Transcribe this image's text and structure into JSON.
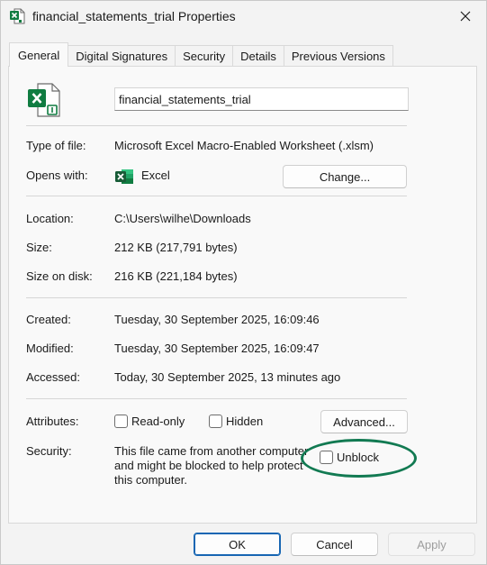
{
  "window": {
    "title": "financial_statements_trial Properties",
    "close_glyph": "✕"
  },
  "tabs": [
    {
      "label": "General",
      "active": true
    },
    {
      "label": "Digital Signatures",
      "active": false
    },
    {
      "label": "Security",
      "active": false
    },
    {
      "label": "Details",
      "active": false
    },
    {
      "label": "Previous Versions",
      "active": false
    }
  ],
  "general": {
    "file_name": "financial_statements_trial",
    "type_label": "Type of file:",
    "type_value": "Microsoft Excel Macro-Enabled Worksheet (.xlsm)",
    "opens_label": "Opens with:",
    "opens_value": "Excel",
    "change_button": "Change...",
    "location_label": "Location:",
    "location_value": "C:\\Users\\wilhe\\Downloads",
    "size_label": "Size:",
    "size_value": "212 KB (217,791 bytes)",
    "size_disk_label": "Size on disk:",
    "size_disk_value": "216 KB (221,184 bytes)",
    "created_label": "Created:",
    "created_value": "Tuesday, 30 September 2025, 16:09:46",
    "modified_label": "Modified:",
    "modified_value": "Tuesday, 30 September 2025, 16:09:47",
    "accessed_label": "Accessed:",
    "accessed_value": "Today, 30 September 2025, 13 minutes ago",
    "attributes_label": "Attributes:",
    "readonly_label": "Read-only",
    "readonly_checked": false,
    "hidden_label": "Hidden",
    "hidden_checked": false,
    "advanced_button": "Advanced...",
    "security_label": "Security:",
    "security_line1": "This file came from another computer",
    "security_line2": "and might be blocked to help protect",
    "security_line3": "this computer.",
    "unblock_label": "Unblock",
    "unblock_checked": false
  },
  "footer": {
    "ok": "OK",
    "cancel": "Cancel",
    "apply": "Apply"
  },
  "colors": {
    "excel_green": "#107c41",
    "highlight_ring": "#127a52",
    "ok_border": "#1766b3"
  },
  "icons": {
    "title_icon": "excel-file-icon",
    "file_icon": "excel-macro-file-icon",
    "opens_icon": "excel-app-icon",
    "close_icon": "close-icon"
  }
}
